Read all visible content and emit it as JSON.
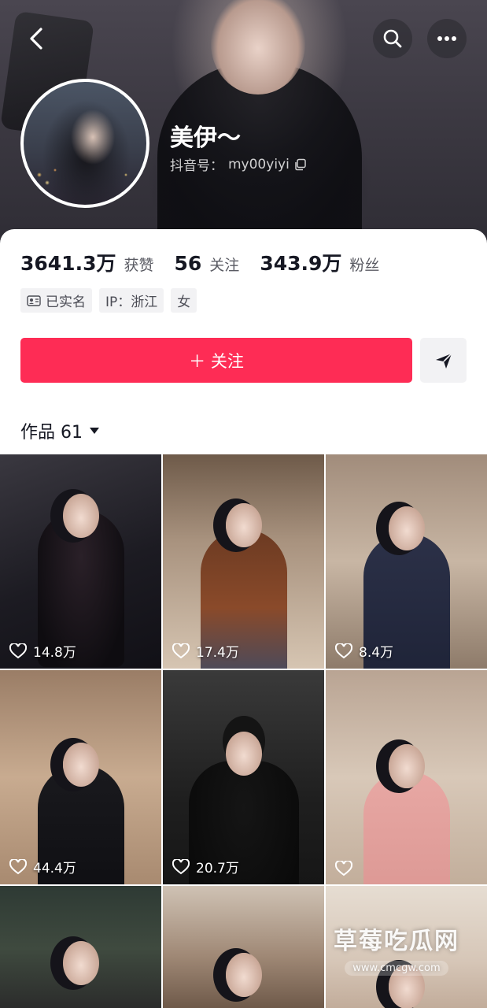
{
  "profile": {
    "nickname": "美伊～",
    "douyin_id_label": "抖音号：",
    "douyin_id": "my00yiyi"
  },
  "stats": [
    {
      "value": "3641.3万",
      "label": "获赞"
    },
    {
      "value": "56",
      "label": "关注"
    },
    {
      "value": "343.9万",
      "label": "粉丝"
    }
  ],
  "tags": [
    {
      "label": "已实名",
      "icon": "id-card-icon"
    },
    {
      "label": "IP：浙江"
    },
    {
      "label": "女"
    }
  ],
  "actions": {
    "follow_label": "＋ 关注",
    "share_icon": "send-icon"
  },
  "works": {
    "label": "作品 61"
  },
  "videos": [
    {
      "likes": "14.8万"
    },
    {
      "likes": "17.4万"
    },
    {
      "likes": "8.4万"
    },
    {
      "likes": "44.4万"
    },
    {
      "likes": "20.7万"
    },
    {
      "likes": ""
    },
    {
      "likes": ""
    },
    {
      "likes": ""
    },
    {
      "likes": ""
    }
  ],
  "watermark": {
    "title": "草莓吃瓜网",
    "url": "www.cmcgw.com"
  },
  "colors": {
    "accent": "#fe2c55",
    "tag_bg": "#f2f2f4"
  }
}
